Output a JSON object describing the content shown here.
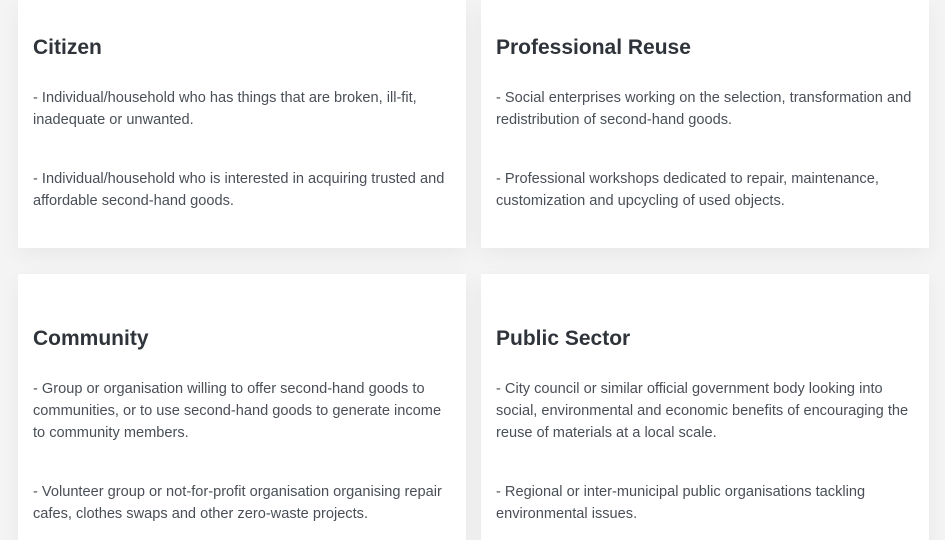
{
  "cards": [
    {
      "title": "Citizen",
      "items": [
        "- Individual/household who has things that are broken, ill-fit, inadequate or unwanted.",
        "- Individual/household who is interested in acquiring trusted and affordable second-hand goods."
      ]
    },
    {
      "title": "Professional Reuse",
      "items": [
        "- Social enterprises working on the selection, transformation and redistribution of second-hand goods.",
        "- Professional workshops dedicated to repair, maintenance, customization and upcycling of used objects."
      ]
    },
    {
      "title": "Community",
      "items": [
        "- Group or organisation willing to offer second-hand goods to communities, or to use second-hand goods to generate income to community members.",
        "- Volunteer group or not-for-profit organisation organising repair cafes, clothes swaps and other zero-waste projects."
      ]
    },
    {
      "title": "Public Sector",
      "items": [
        "- City council or similar official government body looking into social, environmental and economic benefits of encouraging the reuse of materials at a local scale.",
        "- Regional or inter-municipal public organisations tackling environmental issues."
      ]
    }
  ]
}
